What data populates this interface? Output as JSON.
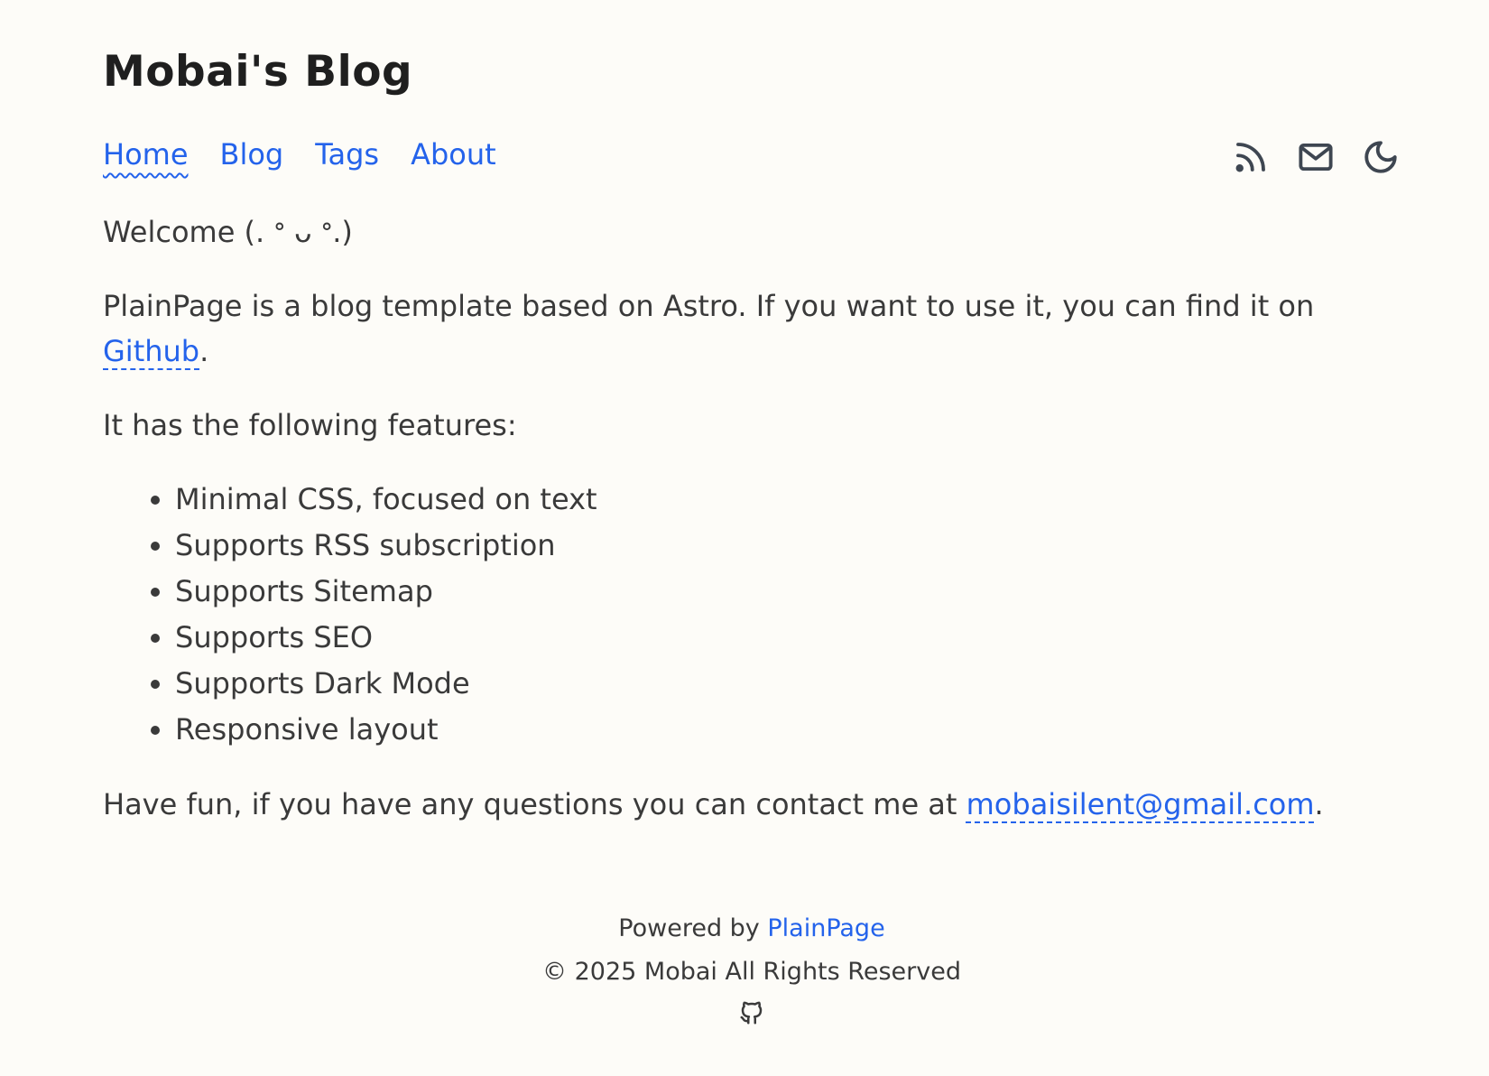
{
  "site": {
    "title": "Mobai's Blog"
  },
  "nav": {
    "items": [
      {
        "label": "Home",
        "active": true
      },
      {
        "label": "Blog",
        "active": false
      },
      {
        "label": "Tags",
        "active": false
      },
      {
        "label": "About",
        "active": false
      }
    ]
  },
  "header_icons": [
    "rss-icon",
    "mail-icon",
    "moon-icon"
  ],
  "content": {
    "welcome": "Welcome (. ᐤ ᴗ ᐤ.)",
    "intro_text": "PlainPage is a blog template based on Astro. If you want to use it, you can find it on ",
    "intro_link": "Github",
    "intro_end": ".",
    "features_heading": "It has the following features:",
    "features": [
      "Minimal CSS, focused on text",
      "Supports RSS subscription",
      "Supports Sitemap",
      "Supports SEO",
      "Supports Dark Mode",
      "Responsive layout"
    ],
    "contact_text": "Have fun, if you have any questions you can contact me at ",
    "contact_email": "mobaisilent@gmail.com",
    "contact_end": "."
  },
  "footer": {
    "powered_prefix": "Powered by ",
    "powered_link": "PlainPage",
    "copyright": "© 2025 Mobai All Rights Reserved"
  },
  "colors": {
    "background": "#fdfcf8",
    "text": "#3a3a3a",
    "link": "#2463eb",
    "icon": "#3e4651"
  }
}
